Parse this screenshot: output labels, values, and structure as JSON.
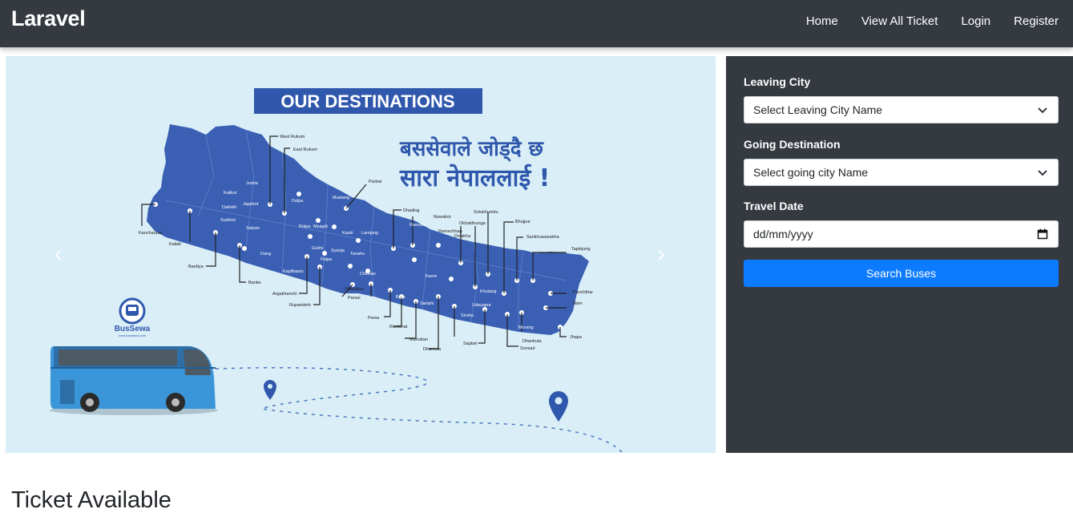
{
  "navbar": {
    "brand": "Laravel",
    "links": [
      "Home",
      "View All Ticket",
      "Login",
      "Register"
    ]
  },
  "banner": {
    "heading": "OUR DESTINATIONS",
    "tagline_line1": "बससेवाले जोड्दै छ",
    "tagline_line2": "सारा नेपाललाई !",
    "logo_text": "BusSewa",
    "logo_url": "www.bussewa.com",
    "prev_glyph": "‹",
    "next_glyph": "›",
    "districts": [
      "West Rukum",
      "East Rukum",
      "Jumla",
      "Kalikot",
      "Dailekh",
      "Jajarkot",
      "Surkhet",
      "Salyan",
      "Dolpa",
      "Mustang",
      "Parbat",
      "Myagdi",
      "Baglung",
      "Kaski",
      "Lamjung",
      "Rolpa",
      "Gulmi",
      "Syanja",
      "Tanahu",
      "Palpa",
      "Dang",
      "Kanchanpur",
      "Kailali",
      "Bardiya",
      "Banke",
      "Kapilbastu",
      "Rupandehi",
      "Argakhanchi",
      "Nawalpur",
      "Parasi",
      "Chitwan",
      "Dhading",
      "Nuwakot",
      "Rasuwa",
      "Ramechhap",
      "Dolakha",
      "Okhaldhunga",
      "Solukhumbu",
      "Bhojpur",
      "Sankhuwasabha",
      "Taplejung",
      "Kavre",
      "Bara",
      "Parsa",
      "Rautahat",
      "Sarlahi",
      "Mahottari",
      "Dhanusa",
      "Siraha",
      "Saptari",
      "Udayapur",
      "Khotang",
      "Morang",
      "Sunsari",
      "Dhankuta",
      "Panchthar",
      "Illam",
      "Jhapa"
    ],
    "colors": {
      "background": "#d9eef6",
      "map": "#3a5fb3",
      "heading_bg": "#2f58ad",
      "bus": "#3b96d9"
    }
  },
  "search": {
    "leaving_label": "Leaving City",
    "leaving_value": "Select Leaving City Name",
    "going_label": "Going Destination",
    "going_value": "Select going city Name",
    "date_label": "Travel Date",
    "date_placeholder": "dd/mm/yyyy",
    "button_label": "Search Buses"
  },
  "section": {
    "title": "Ticket Available"
  },
  "theme": {
    "dark": "#343a40",
    "primary": "#0d7bff"
  }
}
